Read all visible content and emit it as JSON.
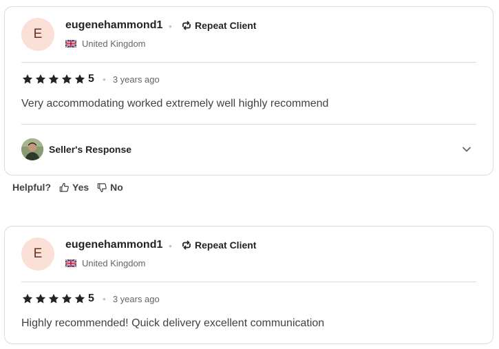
{
  "reviews": [
    {
      "avatar_initial": "E",
      "username": "eugenehammond1",
      "badge": "Repeat Client",
      "country": "United Kingdom",
      "rating": "5",
      "time_ago": "3 years ago",
      "text": "Very accommodating worked extremely well highly recommend",
      "seller_response_label": "Seller's Response"
    },
    {
      "avatar_initial": "E",
      "username": "eugenehammond1",
      "badge": "Repeat Client",
      "country": "United Kingdom",
      "rating": "5",
      "time_ago": "3 years ago",
      "text": "Highly recommended! Quick delivery excellent communication"
    }
  ],
  "helpful": {
    "label": "Helpful?",
    "yes": "Yes",
    "no": "No"
  },
  "colors": {
    "avatar_bg": "#fbe0d8",
    "star": "#222325",
    "border": "#dadbdd"
  }
}
